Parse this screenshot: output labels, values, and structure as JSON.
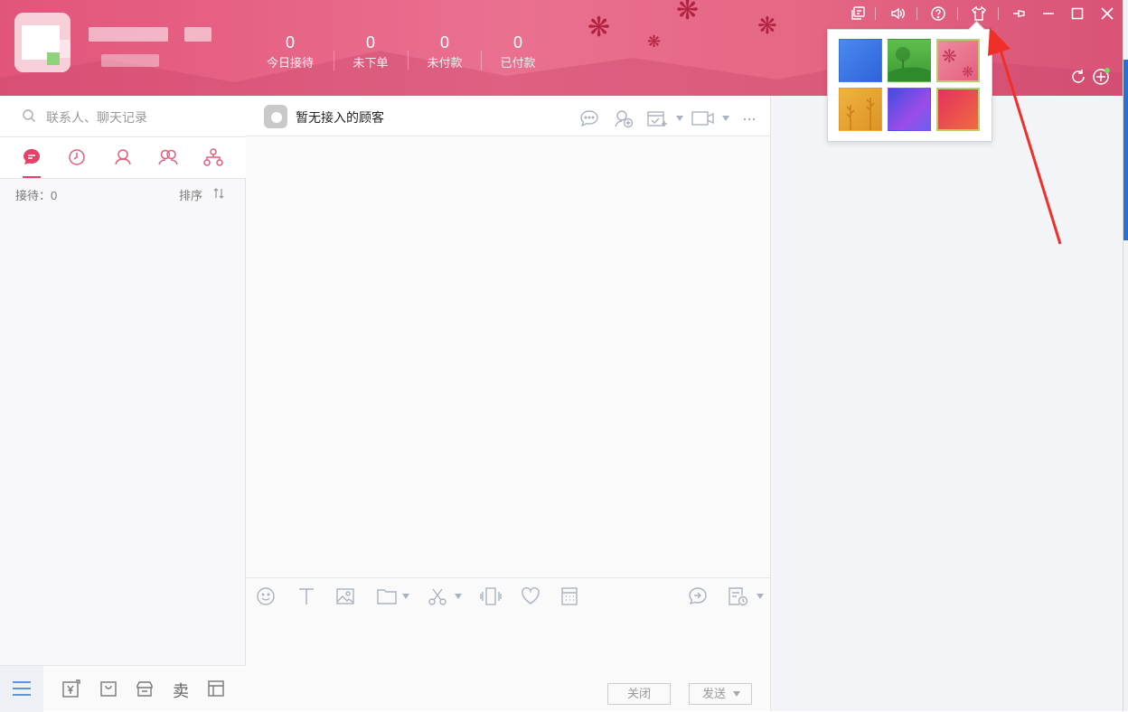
{
  "header": {
    "stats": [
      {
        "value": "0",
        "label": "今日接待"
      },
      {
        "value": "0",
        "label": "未下单"
      },
      {
        "value": "0",
        "label": "未付款"
      },
      {
        "value": "0",
        "label": "已付款"
      }
    ],
    "titlebar_icons": [
      "chat-window-icon",
      "volume-icon",
      "help-icon",
      "skin-icon",
      "pin-icon",
      "minimize-icon",
      "maximize-icon",
      "close-icon"
    ],
    "right_icons": [
      "refresh-icon",
      "add-icon"
    ]
  },
  "skin_popup": {
    "skins": [
      {
        "name": "blue",
        "color": "#3d7be8"
      },
      {
        "name": "green-tree",
        "color": "#49a53a"
      },
      {
        "name": "pink-flower",
        "color": "#e9768f",
        "selected": true
      },
      {
        "name": "golden-wheat",
        "color": "#e8a833"
      },
      {
        "name": "purple-blue",
        "color": "#6a56e8"
      },
      {
        "name": "red-orange",
        "color": "#e8425a"
      }
    ]
  },
  "sidebar": {
    "search_placeholder": "联系人、聊天记录",
    "tabs": [
      "chat-tab",
      "recent-tab",
      "contacts-tab",
      "group-tab",
      "team-tab"
    ],
    "waiting_label": "接待：0",
    "sort_label": "排序",
    "bottom_icons": [
      "menu-icon",
      "rmb-transfer-icon",
      "shopping-bag-icon",
      "store-icon",
      "sell-icon",
      "layout-icon"
    ],
    "sell_label": "卖"
  },
  "chat": {
    "title": "暂无接入的顾客",
    "close_label": "关闭",
    "send_label": "发送"
  },
  "colors": {
    "accent": "#e5416a",
    "header_pink": "#ea7090",
    "arrow_red": "#f03028"
  }
}
